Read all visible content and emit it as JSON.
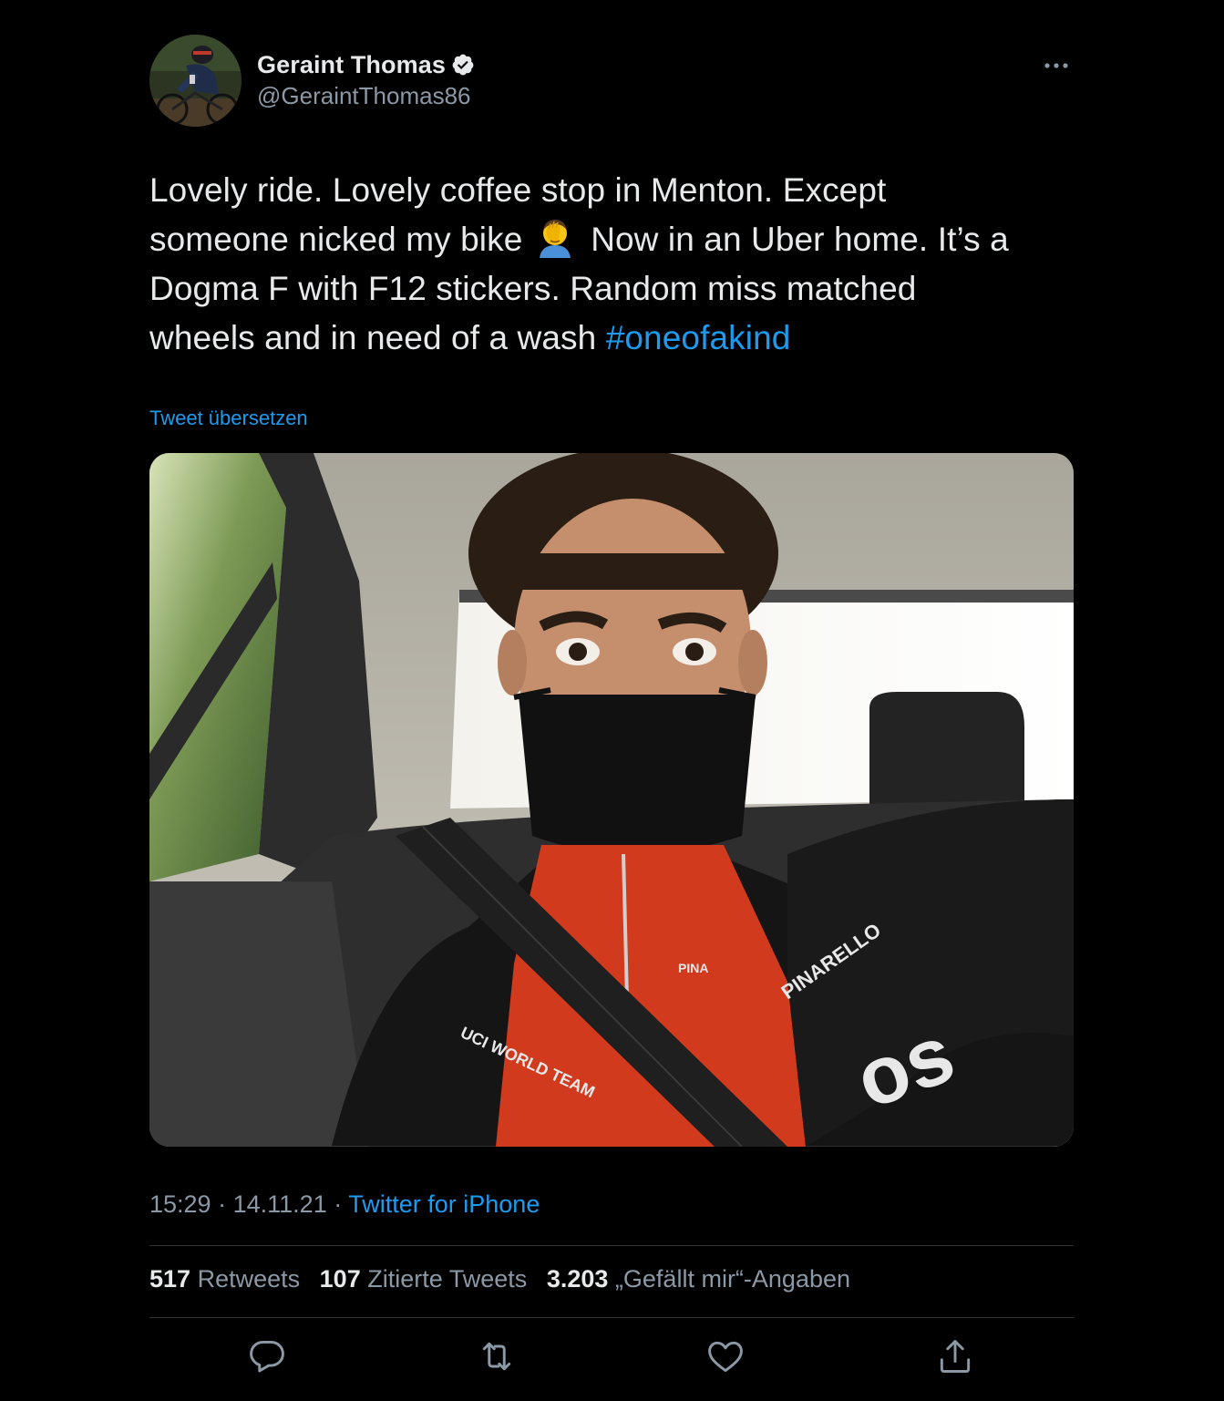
{
  "author": {
    "display_name": "Geraint Thomas",
    "handle": "@GeraintThomas86",
    "verified": true
  },
  "tweet": {
    "text_line1": "Lovely ride. Lovely coffee stop in Menton. Except",
    "text_line2_a": "someone nicked my bike",
    "emoji": "facepalm-icon",
    "text_line2_b": "Now in an Uber home. It’s a",
    "text_line3": "Dogma F with F12 stickers. Random miss matched",
    "text_line4": "wheels and in need of a wash",
    "hashtag": "#oneofakind"
  },
  "translate_label": "Tweet übersetzen",
  "meta": {
    "time": "15:29",
    "separator": "·",
    "date": "14.11.21",
    "source": "Twitter for iPhone"
  },
  "stats": {
    "retweets_count": "517",
    "retweets_label": "Retweets",
    "quotes_count": "107",
    "quotes_label": "Zitierte Tweets",
    "likes_count": "3.203",
    "likes_label": "„Gefällt mir“-Angaben"
  },
  "actions": [
    "reply-icon",
    "retweet-icon",
    "like-icon",
    "share-icon"
  ],
  "colors": {
    "background": "#000000",
    "text": "#e7e9ea",
    "secondary": "#8b98a5",
    "accent": "#1d9bf0",
    "divider": "#2f3336"
  }
}
